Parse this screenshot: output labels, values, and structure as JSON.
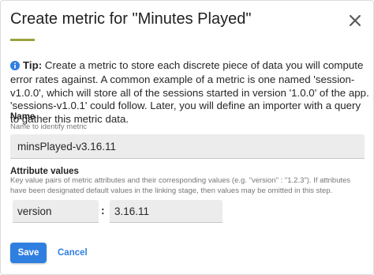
{
  "dialog": {
    "title": "Create metric for \"Minutes Played\"",
    "close_icon": "close-icon"
  },
  "tip": {
    "icon": "info-icon",
    "label": "Tip:",
    "text": " Create a metric to store each discrete piece of data you will compute error rates against. A common example of a metric is one named 'session-v1.0.0', which will store all of the sessions started in version '1.0.0' of the app. 'sessions-v1.0.1' could follow. Later, you will define an importer with a query to gather this metric data."
  },
  "name_field": {
    "label": "Name",
    "help": "Name to identify metric",
    "value": "minsPlayed-v3.16.11"
  },
  "attributes": {
    "label": "Attribute values",
    "help": "Key value pairs of metric attributes and their corresponding values (e.g. \"version\" : \"1.2.3\"). If attributes have been designated default values in the linking stage, then values may be omitted in this step.",
    "key_value": "version",
    "separator": ":",
    "value_value": "3.16.11"
  },
  "actions": {
    "save_label": "Save",
    "cancel_label": "Cancel"
  },
  "colors": {
    "accent": "#2f7fe0",
    "title_underline": "#9aa33f",
    "input_background": "#ececec"
  }
}
